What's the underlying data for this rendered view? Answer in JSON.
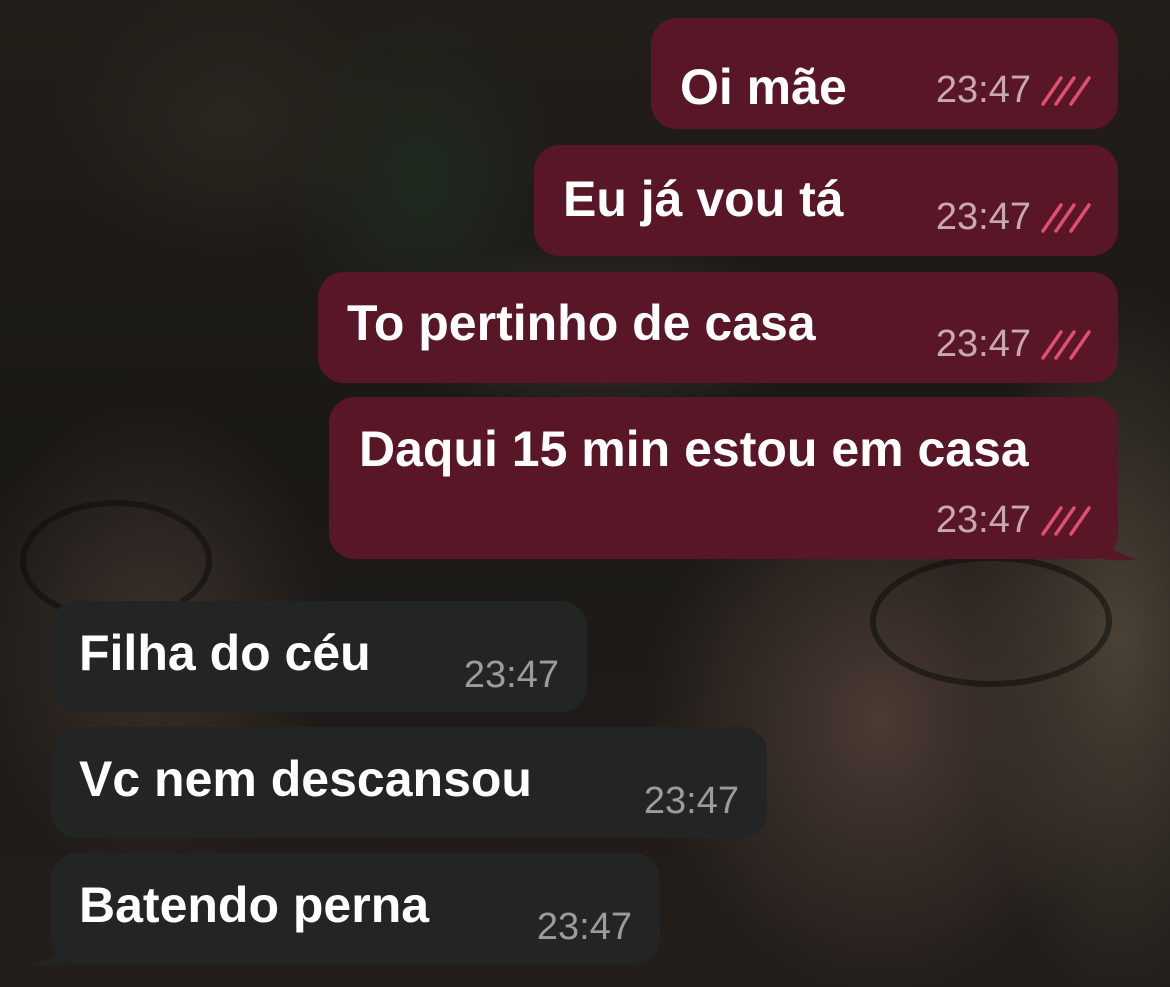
{
  "colors": {
    "outgoing_bubble": "#591627",
    "incoming_bubble": "#232524",
    "read_check": "#e0506e"
  },
  "messages": [
    {
      "direction": "outgoing",
      "text": "Oi mãe",
      "time": "23:47",
      "status_icon": "double-check-read-icon"
    },
    {
      "direction": "outgoing",
      "text": "Eu já vou tá",
      "time": "23:47",
      "status_icon": "double-check-read-icon"
    },
    {
      "direction": "outgoing",
      "text": "To pertinho de casa",
      "time": "23:47",
      "status_icon": "double-check-read-icon"
    },
    {
      "direction": "outgoing",
      "text": "Daqui 15 min estou em casa",
      "time": "23:47",
      "status_icon": "double-check-read-icon"
    },
    {
      "direction": "incoming",
      "text": "Filha do céu",
      "time": "23:47"
    },
    {
      "direction": "incoming",
      "text": "Vc nem descansou",
      "time": "23:47"
    },
    {
      "direction": "incoming",
      "text": "Batendo perna",
      "time": "23:47"
    }
  ]
}
